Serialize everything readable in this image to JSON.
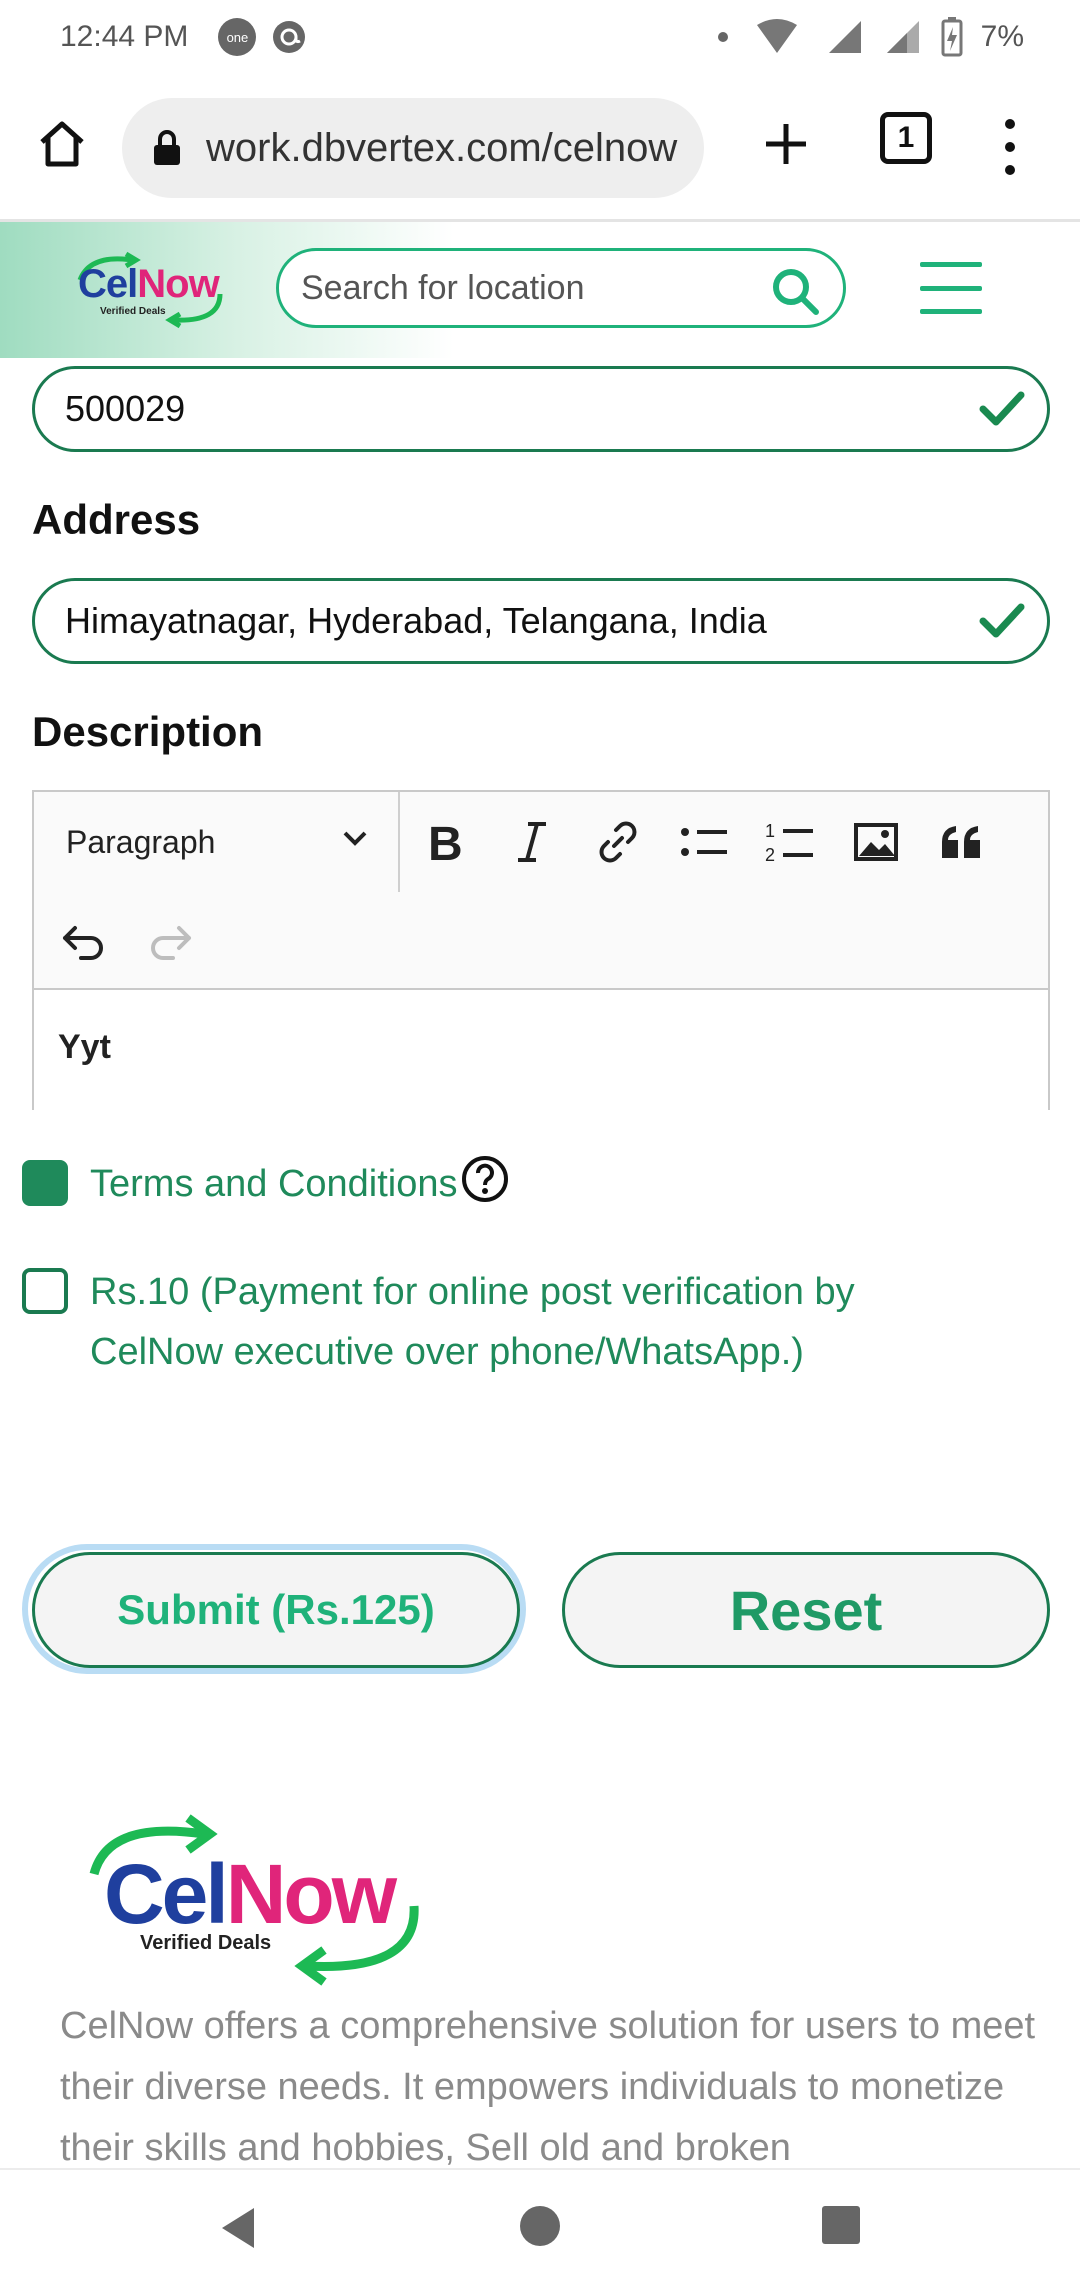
{
  "status_bar": {
    "time": "12:44 PM",
    "app_badge": "one",
    "battery": "7%"
  },
  "browser": {
    "url": "work.dbvertex.com/celnow",
    "tab_count": "1"
  },
  "header": {
    "logo_cel": "Cel",
    "logo_now": "Now",
    "logo_tagline": "Verified Deals",
    "search_placeholder": "Search for location"
  },
  "form": {
    "pincode_value": "500029",
    "address_label": "Address",
    "address_value": "Himayatnagar, Hyderabad, Telangana, India",
    "description_label": "Description",
    "editor": {
      "block_format": "Paragraph",
      "content": "Yyt"
    },
    "terms_label": "Terms and Conditions",
    "terms_checked": true,
    "payment_label": "Rs.10 (Payment for online post verification by CelNow executive over phone/WhatsApp.)",
    "payment_checked": false,
    "submit_label": "Submit (Rs.125)",
    "reset_label": "Reset"
  },
  "footer": {
    "logo_cel": "Cel",
    "logo_now": "Now",
    "logo_tagline": "Verified Deals",
    "about_text": "CelNow offers a comprehensive solution for users to meet their diverse needs. It empowers individuals to monetize their skills and hobbies, Sell old and broken"
  },
  "colors": {
    "accent_green": "#1fb27a",
    "dark_green": "#1a7a50",
    "brand_blue": "#1f3f9e",
    "brand_pink": "#e0257a"
  }
}
